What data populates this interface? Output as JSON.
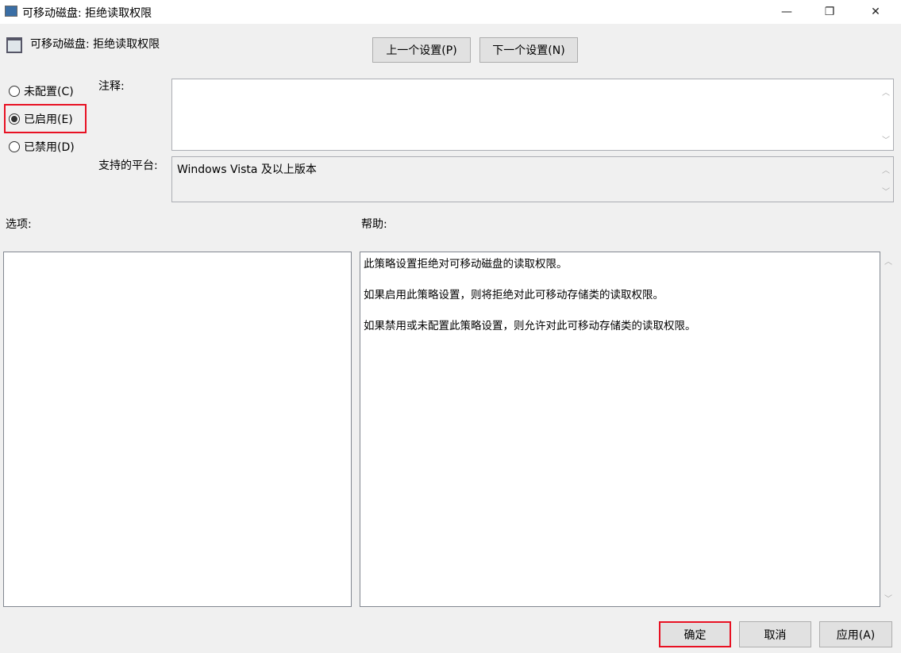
{
  "window": {
    "title": "可移动磁盘: 拒绝读取权限",
    "minimize": "—",
    "maximize": "❐",
    "close": "✕"
  },
  "header": {
    "title": "可移动磁盘: 拒绝读取权限"
  },
  "nav": {
    "prev": "上一个设置(P)",
    "next": "下一个设置(N)"
  },
  "state": {
    "options": [
      {
        "label": "未配置(C)",
        "checked": false
      },
      {
        "label": "已启用(E)",
        "checked": true
      },
      {
        "label": "已禁用(D)",
        "checked": false
      }
    ]
  },
  "comment": {
    "label": "注释:",
    "value": ""
  },
  "platform": {
    "label": "支持的平台:",
    "value": "Windows Vista 及以上版本"
  },
  "options_label": "选项:",
  "help_label": "帮助:",
  "help": [
    "此策略设置拒绝对可移动磁盘的读取权限。",
    "如果启用此策略设置，则将拒绝对此可移动存储类的读取权限。",
    "如果禁用或未配置此策略设置，则允许对此可移动存储类的读取权限。"
  ],
  "footer": {
    "ok": "确定",
    "cancel": "取消",
    "apply": "应用(A)"
  },
  "colors": {
    "highlight": "#e81123"
  }
}
